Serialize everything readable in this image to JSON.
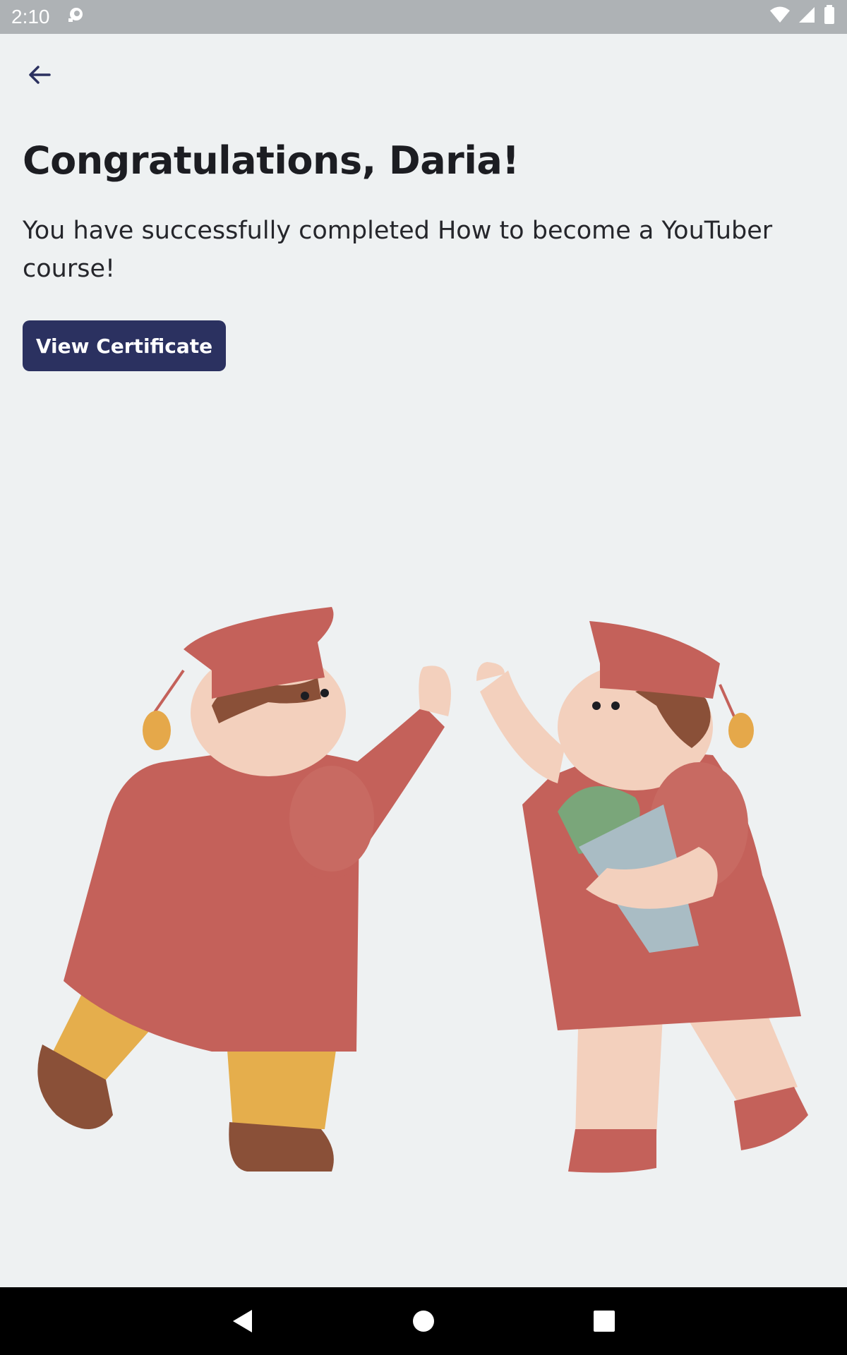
{
  "status_bar": {
    "time": "2:10",
    "icons": [
      "notification-icon",
      "wifi-icon",
      "signal-icon",
      "battery-icon"
    ]
  },
  "header": {
    "back_icon": "back-arrow-icon"
  },
  "main": {
    "title": "Congratulations, Daria!",
    "subtitle": "You have successfully completed How to become a YouTuber course!",
    "cta_label": "View Certificate"
  },
  "illustration": {
    "icon": "graduates-high-five-illustration"
  },
  "nav_bar": {
    "buttons": [
      "back-triangle-icon",
      "home-circle-icon",
      "recents-square-icon"
    ]
  },
  "colors": {
    "background": "#eef1f2",
    "accent": "#2b3160",
    "status_bar": "#aeb2b5",
    "gown": "#c4615a"
  }
}
